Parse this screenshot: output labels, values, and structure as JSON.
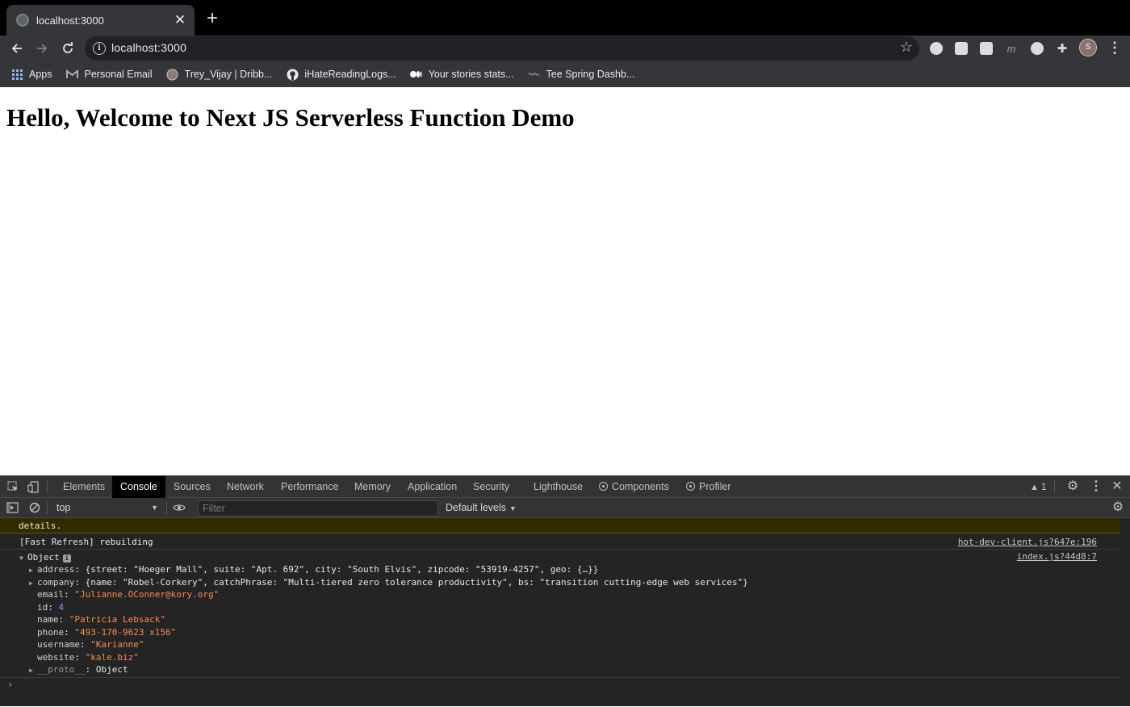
{
  "tab": {
    "title": "localhost:3000"
  },
  "toolbar": {
    "url": "localhost:3000"
  },
  "bookmarks": [
    {
      "label": "Apps",
      "icon": "apps-grid-icon"
    },
    {
      "label": "Personal Email",
      "icon": "gmail-icon"
    },
    {
      "label": "Trey_Vijay | Dribb...",
      "icon": "dribbble-icon"
    },
    {
      "label": "iHateReadingLogs...",
      "icon": "github-icon"
    },
    {
      "label": "Your stories stats...",
      "icon": "medium-icon"
    },
    {
      "label": "Tee Spring Dashb...",
      "icon": "teespring-icon"
    }
  ],
  "profile": {
    "initial": "S"
  },
  "page": {
    "heading": "Hello, Welcome to Next JS Serverless Function Demo"
  },
  "devtools": {
    "tabs": [
      "Elements",
      "Console",
      "Sources",
      "Network",
      "Performance",
      "Memory",
      "Application",
      "Security",
      "Lighthouse",
      "Components",
      "Profiler"
    ],
    "active_tab": "Console",
    "warning_count": "1",
    "context": "top",
    "filter_placeholder": "Filter",
    "levels": "Default levels",
    "console": {
      "warning_text": "details.",
      "refresh_msg": "[Fast Refresh] rebuilding",
      "refresh_src": "hot-dev-client.js?647e:196",
      "object_label": "Object",
      "object_src": "index.js?44d8:7",
      "address_key": "address",
      "address_val": "{street: \"Hoeger Mall\", suite: \"Apt. 692\", city: \"South Elvis\", zipcode: \"53919-4257\", geo: {…}}",
      "company_key": "company",
      "company_val": "{name: \"Robel-Corkery\", catchPhrase: \"Multi-tiered zero tolerance productivity\", bs: \"transition cutting-edge web services\"}",
      "email_key": "email",
      "email_val": "\"Julianne.OConner@kory.org\"",
      "id_key": "id",
      "id_val": "4",
      "name_key": "name",
      "name_val": "\"Patricia Lebsack\"",
      "phone_key": "phone",
      "phone_val": "\"493-170-9623 x156\"",
      "username_key": "username",
      "username_val": "\"Karianne\"",
      "website_key": "website",
      "website_val": "\"kale.biz\"",
      "proto_key": "__proto__",
      "proto_val": "Object"
    }
  }
}
